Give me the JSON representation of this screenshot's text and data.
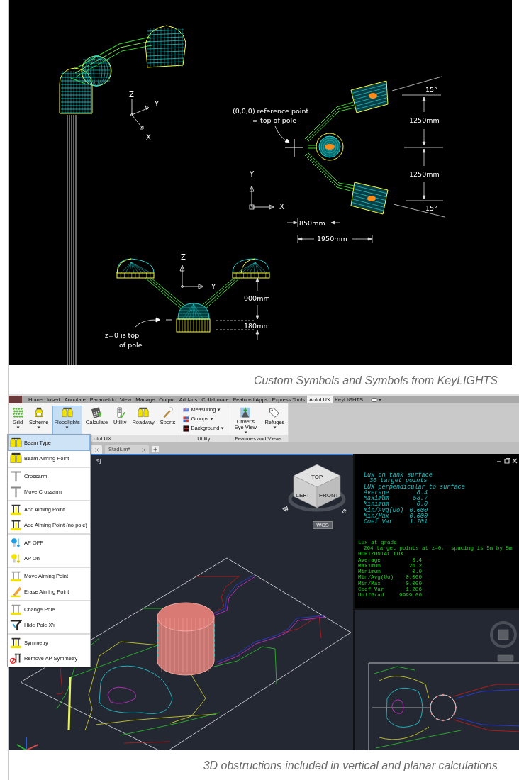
{
  "symbols_figure": {
    "labels": [
      {
        "kind": "axis",
        "text": "Z"
      },
      {
        "kind": "axis",
        "text": "Y"
      },
      {
        "kind": "axis",
        "text": "X"
      },
      {
        "kind": "note",
        "text": "(0,0,0) reference point"
      },
      {
        "kind": "note",
        "text": "= top of pole"
      },
      {
        "kind": "dimension",
        "text": "15°"
      },
      {
        "kind": "dimension",
        "text": "1250mm"
      },
      {
        "kind": "dimension",
        "text": "1250mm"
      },
      {
        "kind": "dimension",
        "text": "15°"
      },
      {
        "kind": "axis",
        "text": "Y"
      },
      {
        "kind": "axis",
        "text": "X"
      },
      {
        "kind": "dimension",
        "text": "850mm"
      },
      {
        "kind": "dimension",
        "text": "1950mm"
      },
      {
        "kind": "axis",
        "text": "Z"
      },
      {
        "kind": "axis",
        "text": "Y"
      },
      {
        "kind": "dimension",
        "text": "900mm"
      },
      {
        "kind": "dimension",
        "text": "180mm"
      },
      {
        "kind": "note",
        "text": "z=0 is top"
      },
      {
        "kind": "note",
        "text": "of pole"
      }
    ],
    "caption": "Custom Symbols and Symbols from KeyLIGHTS"
  },
  "autocad_figure": {
    "ribbon_tabs": [
      {
        "label": "Home",
        "selected": false
      },
      {
        "label": "Insert",
        "selected": false
      },
      {
        "label": "Annotate",
        "selected": false
      },
      {
        "label": "Parametric",
        "selected": false
      },
      {
        "label": "View",
        "selected": false
      },
      {
        "label": "Manage",
        "selected": false
      },
      {
        "label": "Output",
        "selected": false
      },
      {
        "label": "Add-ins",
        "selected": false
      },
      {
        "label": "Collaborate",
        "selected": false
      },
      {
        "label": "Featured Apps",
        "selected": false
      },
      {
        "label": "Express Tools",
        "selected": false
      },
      {
        "label": "AutoLUX",
        "selected": true
      },
      {
        "label": "KeyLIGHTS",
        "selected": false
      }
    ],
    "ribbon_panels": [
      {
        "title": "utoLUX",
        "buttons": [
          {
            "label": "Grid",
            "kind": "large",
            "dropdown": true,
            "selected": false
          },
          {
            "label": "Scheme",
            "kind": "large",
            "dropdown": true,
            "selected": false
          },
          {
            "label": "Floodlights",
            "kind": "large",
            "dropdown": true,
            "selected": true
          },
          {
            "label": "Calculate",
            "kind": "large",
            "dropdown": false,
            "selected": false
          },
          {
            "label": "Utility",
            "kind": "large",
            "dropdown": false,
            "selected": false
          },
          {
            "label": "Roadway",
            "kind": "large",
            "dropdown": false,
            "selected": false
          },
          {
            "label": "Sports",
            "kind": "large",
            "dropdown": false,
            "selected": false
          }
        ]
      },
      {
        "title": "Utility",
        "buttons": [
          {
            "label": "Measuring",
            "kind": "small",
            "dropdown": true,
            "selected": false
          },
          {
            "label": "Groups",
            "kind": "small",
            "dropdown": true,
            "selected": false
          },
          {
            "label": "Background",
            "kind": "small",
            "dropdown": true,
            "selected": false
          }
        ]
      },
      {
        "title": "Features and Views",
        "buttons": [
          {
            "label": "Driver's Eye View",
            "kind": "large",
            "dropdown": true,
            "selected": false
          },
          {
            "label": "Refuges",
            "kind": "large",
            "dropdown": true,
            "selected": false
          }
        ]
      }
    ],
    "doc_tabs": [
      {
        "selected": true
      },
      {
        "label": "Stadium*",
        "selected": false
      }
    ],
    "viewport_label": "s]",
    "viewcube_labels": [
      "TOP",
      "LEFT",
      "FRONT",
      "W",
      "S"
    ],
    "wcs_button": "WCS",
    "floodlights_menu": [
      {
        "label": "Beam Type",
        "selected": true,
        "separator_before": false
      },
      {
        "label": "Beam Aiming Point",
        "selected": false,
        "separator_before": false
      },
      {
        "label": "Crossarm",
        "selected": false,
        "separator_before": true
      },
      {
        "label": "Move Crossarm",
        "selected": false,
        "separator_before": false
      },
      {
        "label": "Add Aiming Point",
        "selected": false,
        "separator_before": true
      },
      {
        "label": "Add Aiming Point (no pole)",
        "selected": false,
        "separator_before": false
      },
      {
        "label": "AP OFF",
        "selected": false,
        "separator_before": true
      },
      {
        "label": "AP On",
        "selected": false,
        "separator_before": false
      },
      {
        "label": "Move Aiming Point",
        "selected": false,
        "separator_before": true
      },
      {
        "label": "Erase Aiming Point",
        "selected": false,
        "separator_before": false
      },
      {
        "label": "Change Pole",
        "selected": false,
        "separator_before": true
      },
      {
        "label": "Hide Pole XY",
        "selected": false,
        "separator_before": false
      },
      {
        "label": "Symmetry",
        "selected": false,
        "separator_before": true
      },
      {
        "label": "Remove AP Symmetry",
        "selected": false,
        "separator_before": false
      }
    ],
    "text_window": {
      "blocks": [
        {
          "kind": "surface",
          "lines": [
            {
              "text": "Lux on tank surface",
              "indent": false
            },
            {
              "text": "36 target points",
              "indent": true
            },
            {
              "text": "LUX perpendicular to surface",
              "indent": false
            }
          ],
          "stats": [
            {
              "label": "Average",
              "value": "8.4"
            },
            {
              "label": "Maximum",
              "value": "53.7"
            },
            {
              "label": "Minimum",
              "value": "0.0"
            },
            {
              "label": "Min/Avg(Uo)",
              "value": "0.000"
            },
            {
              "label": "Min/Max",
              "value": "0.000"
            },
            {
              "label": "Coef Var",
              "value": "1.701"
            }
          ]
        },
        {
          "kind": "grade",
          "lines": [
            {
              "text": "Lux at grade",
              "indent": false
            },
            {
              "text": "264 target points at z=0,  spacing is 5m by 5m",
              "indent": true
            },
            {
              "text": "HORIZONTAL LUX",
              "indent": false
            }
          ],
          "stats": [
            {
              "label": "Average",
              "value": "3.4"
            },
            {
              "label": "Maximum",
              "value": "26.2"
            },
            {
              "label": "Minimum",
              "value": "0.0"
            },
            {
              "label": "Min/Avg(Uo)",
              "value": "0.000"
            },
            {
              "label": "Min/Max",
              "value": "0.000"
            },
            {
              "label": "Coef Var",
              "value": "1.286"
            },
            {
              "label": "UnifGrad",
              "value": "9999.00"
            }
          ]
        }
      ]
    },
    "caption": "3D obstructions included in vertical and planar calculations"
  }
}
